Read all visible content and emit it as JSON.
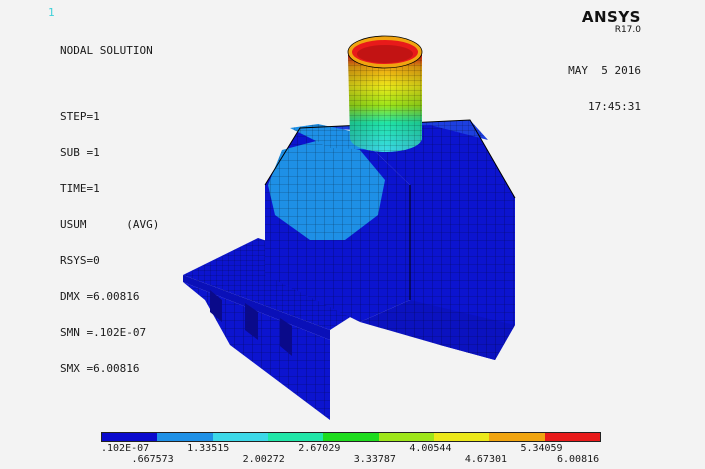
{
  "window_number": "1",
  "header": {
    "title": "NODAL SOLUTION",
    "step": "STEP=1",
    "sub": "SUB =1",
    "time": "TIME=1",
    "result": "USUM      (AVG)",
    "rsys": "RSYS=0",
    "dmx": "DMX =6.00816",
    "smn": "SMN =.102E-07",
    "smx": "SMX =6.00816"
  },
  "brand": {
    "name": "ANSYS",
    "version": "R17.0"
  },
  "datetime": {
    "date": "MAY  5 2016",
    "time": "17:45:31"
  },
  "legend": {
    "colors": [
      "#0a0acd",
      "#1e90e6",
      "#3cd8e8",
      "#20e6a8",
      "#1edc1e",
      "#9ee61a",
      "#ece81a",
      "#f0a410",
      "#e81a1a"
    ],
    "upper_labels": [
      ".102E-07",
      "1.33515",
      "2.67029",
      "4.00544",
      "5.34059"
    ],
    "lower_labels": [
      ".667573",
      "2.00272",
      "3.33787",
      "4.67301",
      "6.00816"
    ]
  }
}
